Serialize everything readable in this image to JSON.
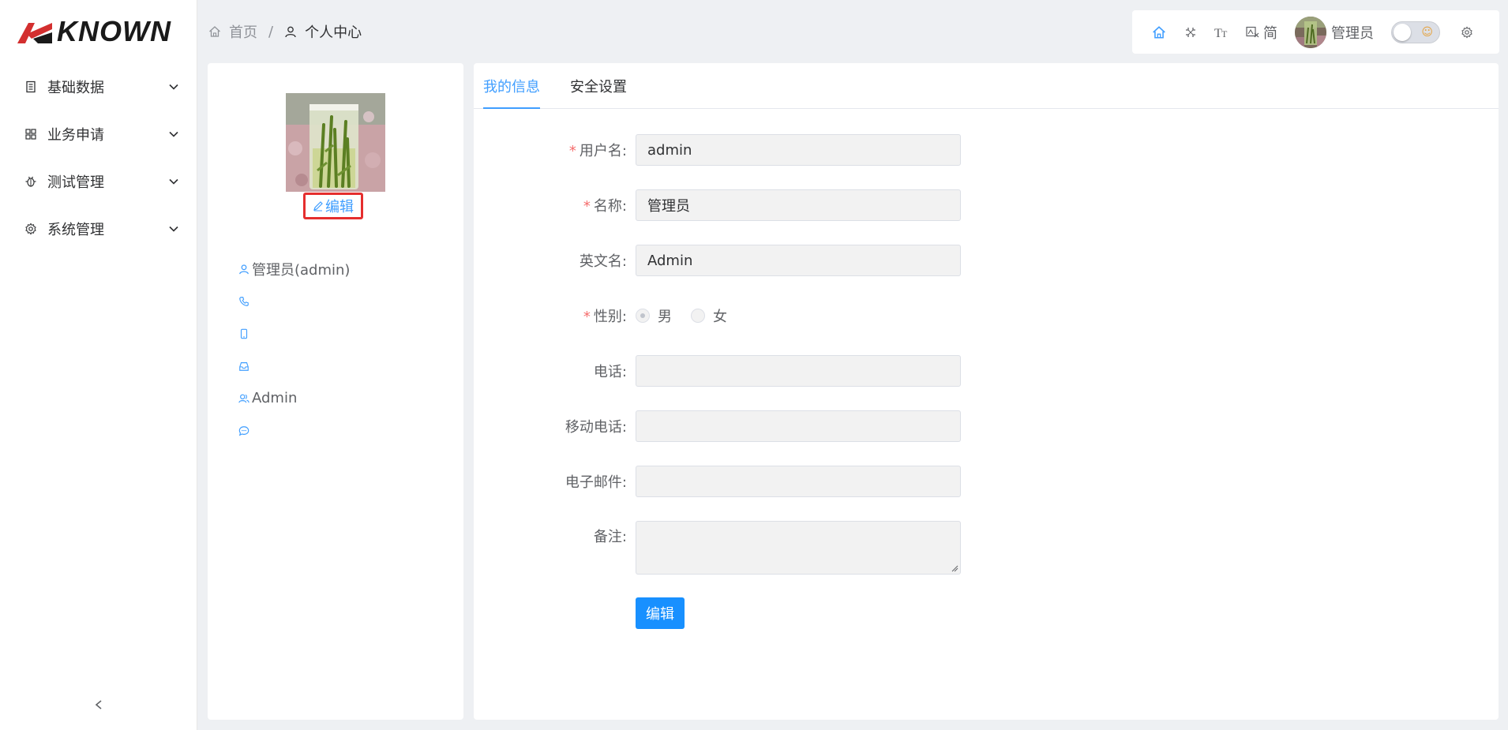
{
  "logo": {
    "text": "KNOWN"
  },
  "sidebar": {
    "items": [
      {
        "label": "基础数据",
        "icon": "document-icon"
      },
      {
        "label": "业务申请",
        "icon": "grid-icon"
      },
      {
        "label": "测试管理",
        "icon": "bug-icon"
      },
      {
        "label": "系统管理",
        "icon": "gear-icon"
      }
    ],
    "collapse": "<"
  },
  "breadcrumb": {
    "home": "首页",
    "separator": "/",
    "current": "个人中心"
  },
  "toolbar": {
    "lang": "简",
    "user_name": "管理员",
    "theme_symbol": "☺"
  },
  "profile": {
    "edit_label": "编辑",
    "name": "管理员(admin)",
    "phone": "",
    "mobile": "",
    "email": "",
    "english_name": "Admin",
    "remark": ""
  },
  "tabs": [
    {
      "label": "我的信息",
      "active": true
    },
    {
      "label": "安全设置",
      "active": false
    }
  ],
  "form": {
    "username": {
      "label": "用户名:",
      "value": "admin",
      "required": true
    },
    "name": {
      "label": "名称:",
      "value": "管理员",
      "required": true
    },
    "english_name": {
      "label": "英文名:",
      "value": "Admin",
      "required": false
    },
    "gender": {
      "label": "性别:",
      "required": true,
      "options": [
        "男",
        "女"
      ],
      "selected": "男"
    },
    "phone": {
      "label": "电话:",
      "value": ""
    },
    "mobile": {
      "label": "移动电话:",
      "value": ""
    },
    "email": {
      "label": "电子邮件:",
      "value": ""
    },
    "remark": {
      "label": "备注:",
      "value": ""
    },
    "submit_label": "编辑",
    "required_mark": "*"
  },
  "colors": {
    "accent": "#409eff",
    "button": "#1890ff",
    "required": "#f56c6c",
    "highlight_box": "#e52e2e"
  }
}
